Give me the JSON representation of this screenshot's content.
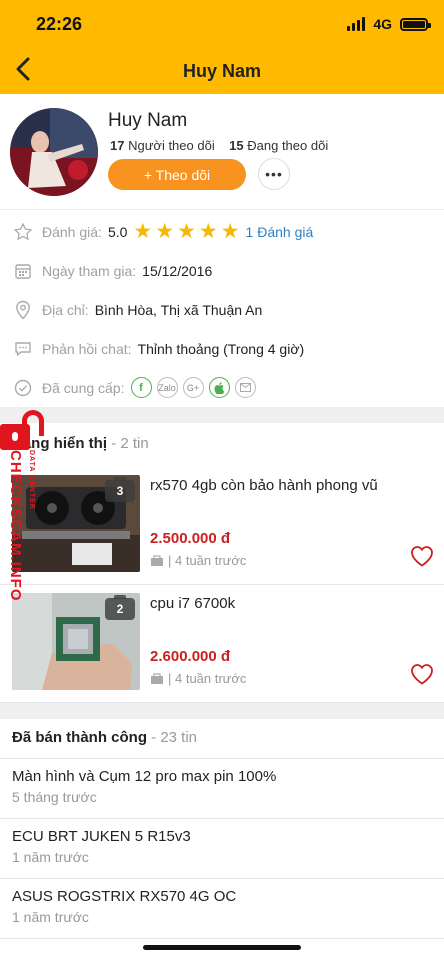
{
  "status_bar": {
    "time": "22:26",
    "network": "4G"
  },
  "nav": {
    "title": "Huy Nam"
  },
  "profile": {
    "name": "Huy Nam",
    "followers_count": "17",
    "followers_label": "Người theo dõi",
    "following_count": "15",
    "following_label": "Đang theo dõi",
    "follow_button": "+ Theo dõi",
    "more_button": "•••"
  },
  "info": {
    "rating_label": "Đánh giá:",
    "rating_value": "5.0",
    "rating_stars": 5,
    "rating_link": "1 Đánh giá",
    "join_label": "Ngày tham gia:",
    "join_value": "15/12/2016",
    "address_label": "Địa chỉ:",
    "address_value": "Bình Hòa, Thị xã Thuận An",
    "chat_label": "Phản hồi chat:",
    "chat_value": "Thỉnh thoảng (Trong 4 giờ)",
    "provided_label": "Đã cung cấp:",
    "provided_icons": [
      "f",
      "Zalo",
      "G+",
      "apple",
      "mail"
    ]
  },
  "showing": {
    "title": "Đang hiển thị",
    "count": "- 2 tin",
    "listings": [
      {
        "title": "rx570 4gb còn bảo hành phong vũ",
        "price": "2.500.000 đ",
        "time": "| 4 tuần trước",
        "photos": "3"
      },
      {
        "title": "cpu i7 6700k",
        "price": "2.600.000 đ",
        "time": "| 4 tuần trước",
        "photos": "2"
      }
    ]
  },
  "sold": {
    "title": "Đã bán thành công",
    "count": "- 23 tin",
    "items": [
      {
        "title": "Màn hình và Cụm 12 pro max pin 100%",
        "time": "5 tháng trước"
      },
      {
        "title": "ECU BRT JUKEN 5  R15v3",
        "time": "1 năm trước"
      },
      {
        "title": "ASUS ROGSTRIX RX570 4G OC",
        "time": "1 năm trước"
      }
    ]
  },
  "watermark": {
    "main": "CHECKSCAM.INFO",
    "sub": "DATA CENTER"
  },
  "colors": {
    "header": "#ffba00",
    "follow_button": "#f7931e",
    "price": "#cc1f1f",
    "star": "#f6b800",
    "link": "#2f80c3"
  }
}
